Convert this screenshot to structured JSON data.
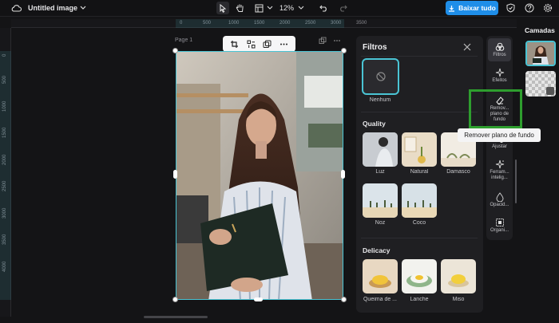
{
  "topbar": {
    "title": "Untitled image",
    "zoom": "12%",
    "download_label": "Baixar tudo"
  },
  "ruler": {
    "h_ticks": [
      "0",
      "500",
      "1000",
      "1500",
      "2000",
      "2500",
      "3000",
      "3500"
    ],
    "v_ticks": [
      "0",
      "500",
      "1000",
      "1500",
      "2000",
      "2500",
      "3000",
      "3500",
      "4000"
    ]
  },
  "canvas": {
    "page_label": "Page 1"
  },
  "filters": {
    "title": "Filtros",
    "none_label": "Nenhum",
    "quality_title": "Quality",
    "quality_items": [
      "Luz",
      "Natural",
      "Damasco",
      "Noz",
      "Coco"
    ],
    "delicacy_title": "Delicacy",
    "delicacy_items": [
      "Queima de ...",
      "Lanche",
      "Miso"
    ]
  },
  "tools": {
    "items": [
      "Filtros",
      "Efeitos",
      "Remov... plano de fundo",
      "Ajustar",
      "Ferram... intelig...",
      "Opacid...",
      "Organi..."
    ]
  },
  "layers": {
    "title": "Camadas"
  },
  "tooltip": "Remover plano de fundo",
  "colors": {
    "accent": "#1f8ee8",
    "selection": "#4ac4d4",
    "highlight": "#2e9e2e"
  }
}
